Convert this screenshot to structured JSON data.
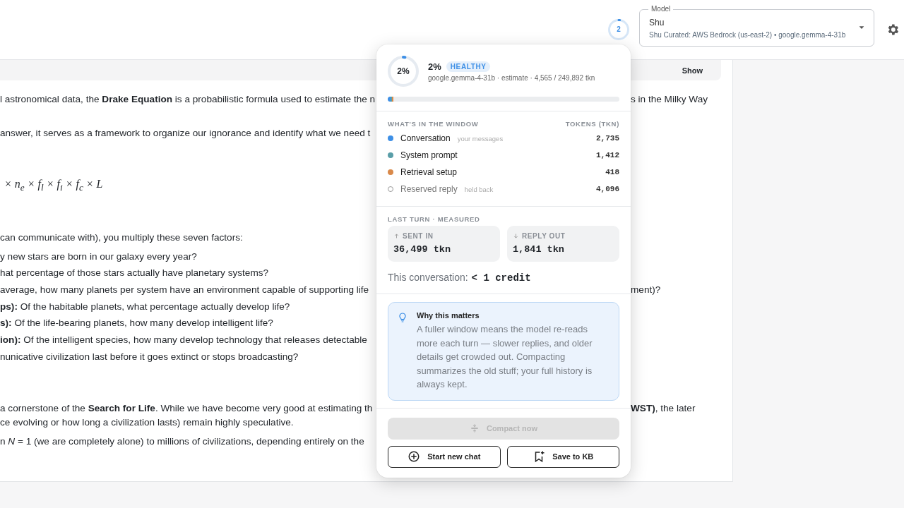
{
  "header": {
    "context_ring": {
      "label": "2",
      "level": 0.02
    },
    "model_select": {
      "legend": "Model",
      "value": "Shu",
      "detail": "Shu Curated: AWS Bedrock (us-east-2) • google.gemma-4-31b"
    }
  },
  "chat": {
    "collapsed_bar": {
      "button": "Show"
    },
    "blocks": [
      {
        "kind": "para",
        "lines": [
          {
            "left": "l astronomical data, the **Drake Equation** is a probabilistic formula used to estimate the n",
            "right": "s in the Milky Way"
          }
        ]
      },
      {
        "kind": "para",
        "lines": [
          {
            "left": "answer, it serves as a framework to organize our ignorance and identify what we need t"
          }
        ]
      },
      {
        "kind": "math",
        "lines": [
          {
            "left": "× n$_{e}$ × f$_{l}$ × f$_{i}$ × f$_{c}$ × L"
          }
        ]
      },
      {
        "kind": "list",
        "lines": [
          {
            "left": "can communicate with), you multiply these seven factors:"
          },
          {
            "left": "y new stars are born in our galaxy every year?"
          },
          {
            "left": "hat percentage of those stars actually have planetary systems?"
          },
          {
            "left": "average, how many planets per system have an environment capable of supporting life",
            "right": "ment)?"
          },
          {
            "left": "**ps):** Of the habitable planets, what percentage actually develop life?"
          },
          {
            "left": "**s):** Of the life-bearing planets, how many develop intelligent life?"
          },
          {
            "left": "**ion):** Of the intelligent species, how many develop technology that releases detectable"
          },
          {
            "left": "nunicative civilization last before it goes extinct or stops broadcasting?"
          }
        ]
      },
      {
        "kind": "para",
        "lines": [
          {
            "left": "a cornerstone of the **Search for Life**. While we have become very good at estimating th",
            "right": "**WST)**, the later"
          },
          {
            "left": "ce evolving or how long a civilization lasts) remain highly speculative."
          }
        ]
      },
      {
        "kind": "para",
        "lines": [
          {
            "left": "n *N* = 1 (we are completely alone) to millions of civilizations, depending entirely on the"
          }
        ]
      }
    ]
  },
  "popover": {
    "ring": {
      "label": "2%",
      "level": 0.02
    },
    "title": "2%",
    "badge": "HEALTHY",
    "subtitle": "google.gemma-4-31b · estimate · 4,565 / 249,892 tkn",
    "usage_bar": {
      "segments": [
        {
          "level": 0.011,
          "color": "#3d8fe6"
        },
        {
          "level": 0.006,
          "color": "#5a9ea8"
        },
        {
          "level": 0.002,
          "color": "#d9894a"
        }
      ]
    },
    "window_section": {
      "heading": "WHAT'S IN THE WINDOW",
      "column": "TOKENS (TKN)",
      "rows": [
        {
          "kind": "used",
          "label": "Conversation",
          "note": "your messages",
          "value": "2,735",
          "color": "#3d8fe6"
        },
        {
          "kind": "used",
          "label": "System prompt",
          "value": "1,412",
          "color": "#5a9ea8"
        },
        {
          "kind": "used",
          "label": "Retrieval setup",
          "value": "418",
          "color": "#d9894a"
        },
        {
          "kind": "reserved",
          "label": "Reserved reply",
          "note": "held back",
          "value": "4,096"
        }
      ]
    },
    "last_turn": {
      "heading": "LAST TURN · MEASURED",
      "stats": [
        {
          "kind": "in",
          "label": "SENT IN",
          "value": "36,499 tkn"
        },
        {
          "kind": "out",
          "label": "REPLY OUT",
          "value": "1,841 tkn"
        }
      ],
      "summary_label": "This conversation:",
      "summary_value": "< 1 credit"
    },
    "tip": {
      "title": "Why this matters",
      "body": "A fuller window means the model re-reads more each turn — slower replies, and older details get crowded out. Compacting summarizes the old stuff; your full history is always kept."
    },
    "compact_button": {
      "label": "Compact now",
      "disabled": true
    },
    "actions": [
      {
        "kind": "new-chat",
        "label": "Start new chat"
      },
      {
        "kind": "save-kb",
        "label": "Save to KB"
      }
    ]
  }
}
